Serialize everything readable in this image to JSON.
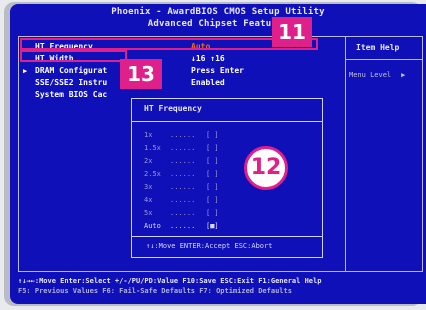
{
  "header": {
    "line1": "Phoenix - AwardBIOS CMOS Setup Utility",
    "line2": "Advanced Chipset Features"
  },
  "help": {
    "title": "Item Help",
    "menu_level": "Menu Level",
    "menu_level_arrow": "▶"
  },
  "settings": [
    {
      "label": "HT Frequency",
      "value": "Auto",
      "selected": true,
      "submenu": false
    },
    {
      "label": "HT Width",
      "value": "↓16 ↑16",
      "selected": false,
      "submenu": false
    },
    {
      "label": "DRAM Configurat",
      "value": "Press Enter",
      "selected": false,
      "submenu": true
    },
    {
      "label": "SSE/SSE2 Instru",
      "value": "Enabled",
      "selected": false,
      "submenu": false
    },
    {
      "label": "System BIOS Cac",
      "value": "",
      "selected": false,
      "submenu": false
    }
  ],
  "popup": {
    "title": "HT Frequency",
    "options": [
      {
        "label": "1x",
        "dots": "......",
        "box": "[ ]"
      },
      {
        "label": "1.5x",
        "dots": "......",
        "box": "[ ]"
      },
      {
        "label": "2x",
        "dots": "......",
        "box": "[ ]"
      },
      {
        "label": "2.5x",
        "dots": "......",
        "box": "[ ]"
      },
      {
        "label": "3x",
        "dots": "......",
        "box": "[ ]"
      },
      {
        "label": "4x",
        "dots": "......",
        "box": "[ ]"
      },
      {
        "label": "5x",
        "dots": "......",
        "box": "[ ]"
      },
      {
        "label": "Auto",
        "dots": "......",
        "box": "[■]"
      }
    ],
    "footer": "↑↓:Move ENTER:Accept ESC:Abort"
  },
  "footer": {
    "line1": "↑↓→←:Move  Enter:Select  +/-/PU/PD:Value  F10:Save  ESC:Exit  F1:General Help",
    "line2": "F5: Previous Values    F6: Fail-Safe Defaults    F7: Optimized Defaults"
  },
  "callouts": {
    "c11": "11",
    "c12": "12",
    "c13": "13"
  },
  "colors": {
    "bios_blue": "#1010b8",
    "highlight_value": "#ff6a00",
    "callout_magenta": "#e0208a"
  }
}
